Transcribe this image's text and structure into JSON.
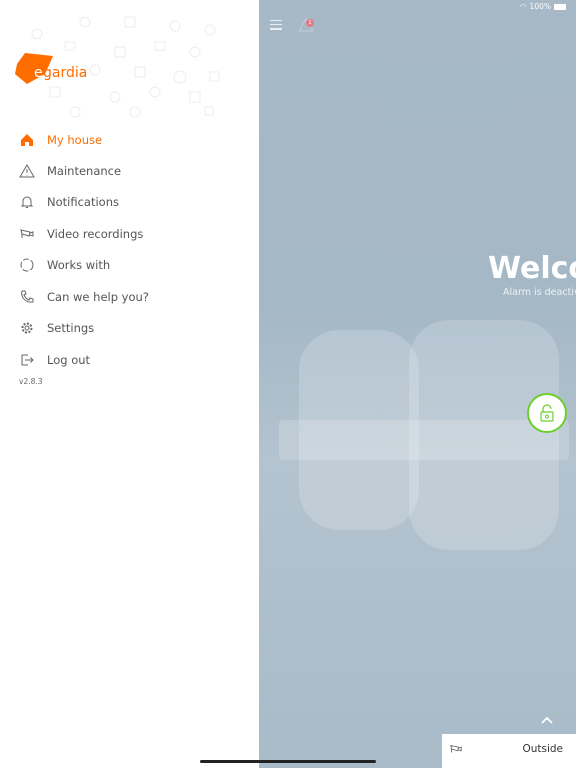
{
  "brand": {
    "logo_text": "egardia",
    "accent": "#ff6c00"
  },
  "menu": {
    "items": [
      {
        "label": "My house",
        "icon": "home-icon",
        "active": true
      },
      {
        "label": "Maintenance",
        "icon": "warning-icon"
      },
      {
        "label": "Notifications",
        "icon": "bell-icon"
      },
      {
        "label": "Video recordings",
        "icon": "camera-icon"
      },
      {
        "label": "Works with",
        "icon": "connections-icon"
      },
      {
        "label": "Can we help you?",
        "icon": "phone-icon"
      },
      {
        "label": "Settings",
        "icon": "gear-icon"
      },
      {
        "label": "Log out",
        "icon": "logout-icon"
      }
    ]
  },
  "version": "v2.8.3",
  "status_bar": {
    "battery": "100%"
  },
  "header": {
    "badge_count": "1"
  },
  "main": {
    "welcome": "Welcome",
    "alarm_status": "Alarm is deactivated",
    "lock_color": "#6ccf2e"
  },
  "camera_card": {
    "label": "Outside"
  }
}
